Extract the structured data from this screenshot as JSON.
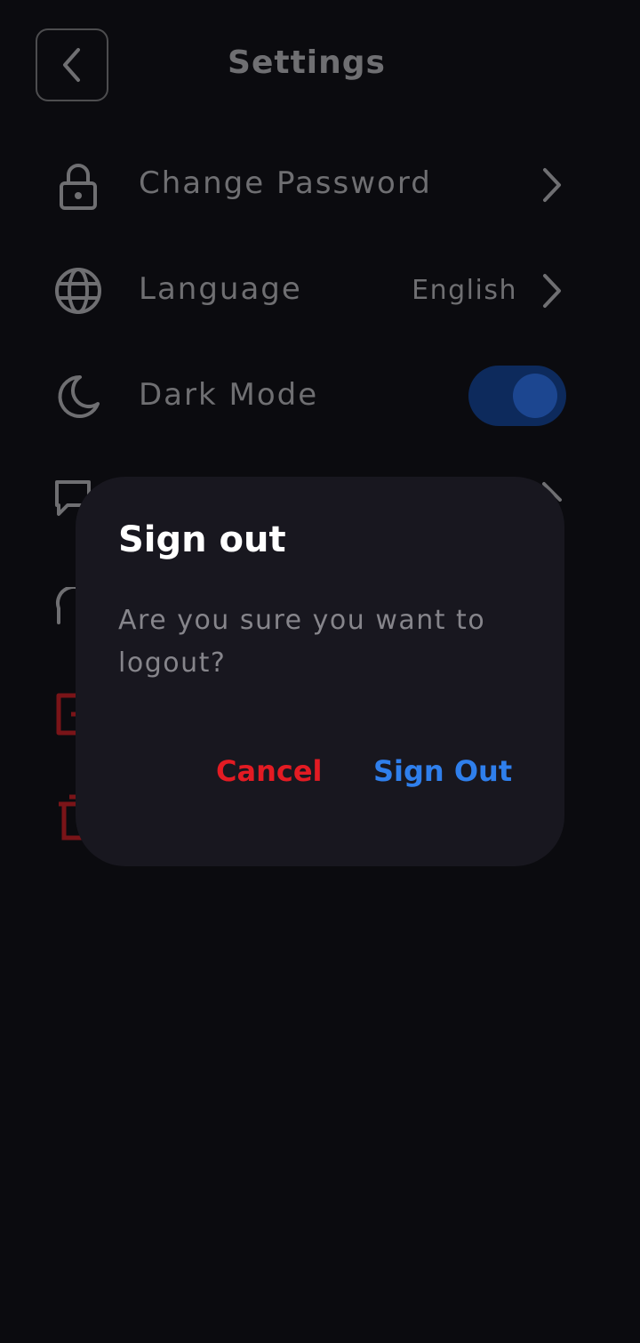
{
  "header": {
    "title": "Settings",
    "back_icon": "chevron-left-icon"
  },
  "settings": {
    "change_password": {
      "label": "Change Password",
      "icon": "lock-icon"
    },
    "language": {
      "label": "Language",
      "value": "English",
      "icon": "globe-icon"
    },
    "dark_mode": {
      "label": "Dark Mode",
      "icon": "moon-icon",
      "enabled": true
    }
  },
  "dialog": {
    "title": "Sign out",
    "message": "Are you sure you want to logout?",
    "cancel_label": "Cancel",
    "confirm_label": "Sign Out"
  },
  "colors": {
    "background": "#0b0b0f",
    "dialog_background": "#18171f",
    "cancel": "#e31b23",
    "confirm": "#2f7fec",
    "toggle_track": "#0d2a5c",
    "toggle_knob": "#1c4690"
  }
}
